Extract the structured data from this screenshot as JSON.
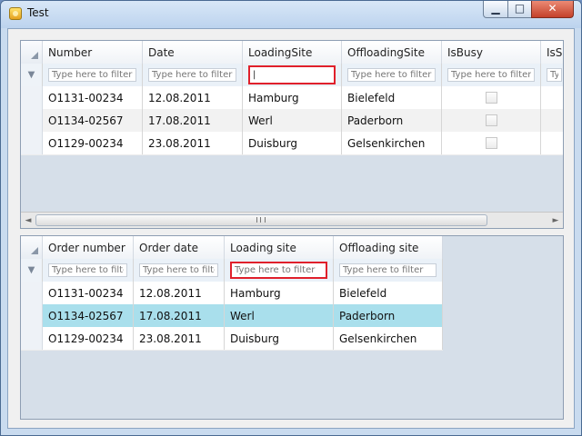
{
  "window": {
    "title": "Test",
    "icon": "app-icon",
    "controls": {
      "minimize": "▁",
      "maximize": "□",
      "close": "✕"
    }
  },
  "grid1": {
    "headers": [
      "Number",
      "Date",
      "LoadingSite",
      "OffloadingSite",
      "IsBusy",
      "IsSel"
    ],
    "filter_placeholder": "Type here to filter",
    "filter_value": "|",
    "rows": [
      {
        "number": "O1131-00234",
        "date": "12.08.2011",
        "loading": "Hamburg",
        "offloading": "Bielefeld"
      },
      {
        "number": "O1134-02567",
        "date": "17.08.2011",
        "loading": "Werl",
        "offloading": "Paderborn"
      },
      {
        "number": "O1129-00234",
        "date": "23.08.2011",
        "loading": "Duisburg",
        "offloading": "Gelsenkirchen"
      }
    ],
    "scrollbar": {
      "left_arrow": "◄",
      "right_arrow": "►"
    }
  },
  "grid2": {
    "headers": [
      "Order number",
      "Order date",
      "Loading site",
      "Offloading site"
    ],
    "filter_placeholder": "Type here to filter",
    "rows": [
      {
        "number": "O1131-00234",
        "date": "12.08.2011",
        "loading": "Hamburg",
        "offloading": "Bielefeld"
      },
      {
        "number": "O1134-02567",
        "date": "17.08.2011",
        "loading": "Werl",
        "offloading": "Paderborn"
      },
      {
        "number": "O1129-00234",
        "date": "23.08.2011",
        "loading": "Duisburg",
        "offloading": "Gelsenkirchen"
      }
    ]
  },
  "colors": {
    "selected_row": "#a9dfec",
    "filter_highlight": "#e0202b"
  },
  "icons": {
    "filter": "▼"
  }
}
